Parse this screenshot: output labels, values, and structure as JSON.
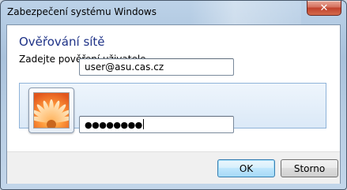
{
  "window": {
    "title": "Zabezpečení systému Windows",
    "close_label": "✕"
  },
  "header": {
    "title": "Ověřování sítě",
    "subtitle": "Zadejte pověření uživatele"
  },
  "credentials": {
    "username_value": "user@asu.cas.cz",
    "password_value": "●●●●●●●●",
    "avatar_icon": "user-tile-flower-icon"
  },
  "buttons": {
    "ok_label": "OK",
    "cancel_label": "Storno"
  },
  "colors": {
    "title_blue": "#1e3287",
    "panel_border": "#8fb3d9",
    "ok_border": "#3c7fb1"
  }
}
